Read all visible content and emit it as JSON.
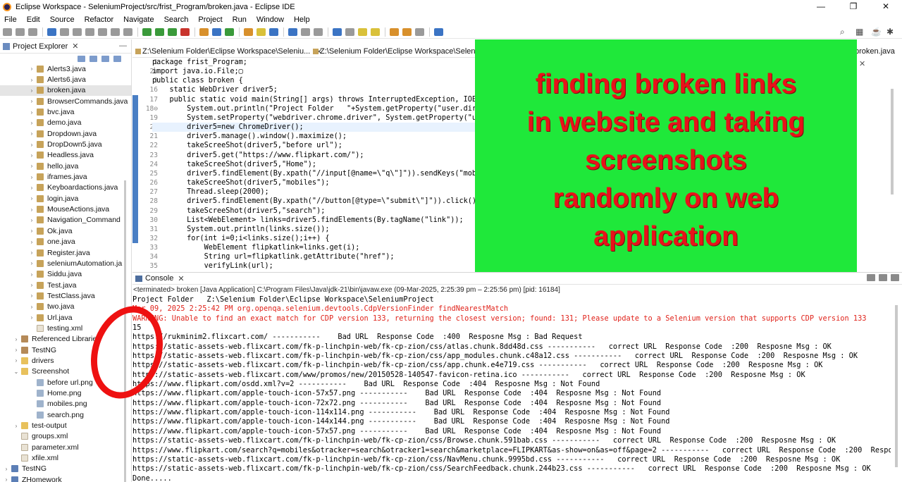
{
  "window": {
    "title": "Eclipse Workspace - SeleniumProject/src/frist_Program/broken.java - Eclipse IDE",
    "controls": [
      "—",
      "❐",
      "✕"
    ]
  },
  "menu": [
    "File",
    "Edit",
    "Source",
    "Refactor",
    "Navigate",
    "Search",
    "Project",
    "Run",
    "Window",
    "Help"
  ],
  "project_explorer": {
    "label": "Project Explorer",
    "close": "✕",
    "items": [
      {
        "name": "Alerts3.java",
        "type": "java",
        "level": 2
      },
      {
        "name": "Alerts6.java",
        "type": "java",
        "level": 2
      },
      {
        "name": "broken.java",
        "type": "java",
        "level": 2,
        "selected": true
      },
      {
        "name": "BrowserCommands.java",
        "type": "java",
        "level": 2
      },
      {
        "name": "bvc.java",
        "type": "java",
        "level": 2
      },
      {
        "name": "demo.java",
        "type": "java",
        "level": 2
      },
      {
        "name": "Dropdown.java",
        "type": "java",
        "level": 2
      },
      {
        "name": "DropDown5.java",
        "type": "java",
        "level": 2
      },
      {
        "name": "Headless.java",
        "type": "java",
        "level": 2
      },
      {
        "name": "hello.java",
        "type": "java",
        "level": 2
      },
      {
        "name": "iframes.java",
        "type": "java",
        "level": 2
      },
      {
        "name": "Keyboardactions.java",
        "type": "java",
        "level": 2
      },
      {
        "name": "login.java",
        "type": "java",
        "level": 2
      },
      {
        "name": "MouseActions.java",
        "type": "java",
        "level": 2
      },
      {
        "name": "Navigation_Command",
        "type": "java",
        "level": 2
      },
      {
        "name": "Ok.java",
        "type": "java",
        "level": 2
      },
      {
        "name": "one.java",
        "type": "java",
        "level": 2
      },
      {
        "name": "Register.java",
        "type": "java",
        "level": 2
      },
      {
        "name": "seleniumAutomation.ja",
        "type": "java",
        "level": 2
      },
      {
        "name": "Siddu.java",
        "type": "java",
        "level": 2
      },
      {
        "name": "Test.java",
        "type": "java",
        "level": 2
      },
      {
        "name": "TestClass.java",
        "type": "java",
        "level": 2
      },
      {
        "name": "two.java",
        "type": "java",
        "level": 2
      },
      {
        "name": "Url.java",
        "type": "java",
        "level": 2
      },
      {
        "name": "testing.xml",
        "type": "xml",
        "level": 2,
        "noarrow": true
      },
      {
        "name": "Referenced Libraries",
        "type": "lib",
        "level": 1
      },
      {
        "name": "TestNG",
        "type": "lib",
        "level": 1
      },
      {
        "name": "drivers",
        "type": "folder",
        "level": 1
      },
      {
        "name": "Screenshot",
        "type": "folder",
        "level": 1,
        "expanded": true
      },
      {
        "name": "before url.png",
        "type": "png",
        "level": 2,
        "noarrow": true
      },
      {
        "name": "Home.png",
        "type": "png",
        "level": 2,
        "noarrow": true
      },
      {
        "name": "mobiles.png",
        "type": "png",
        "level": 2,
        "noarrow": true
      },
      {
        "name": "search.png",
        "type": "png",
        "level": 2,
        "noarrow": true
      },
      {
        "name": "test-output",
        "type": "folder",
        "level": 1
      },
      {
        "name": "groups.xml",
        "type": "xml",
        "level": 1,
        "noarrow": true
      },
      {
        "name": "parameter.xml",
        "type": "xml",
        "level": 1,
        "noarrow": true
      },
      {
        "name": "xfile.xml",
        "type": "xml",
        "level": 1,
        "noarrow": true
      },
      {
        "name": "TestNG",
        "type": "proj",
        "level": 0
      },
      {
        "name": "ZHomework",
        "type": "proj",
        "level": 0
      }
    ]
  },
  "editor": {
    "tabs": [
      "Z:\\Selenium Folder\\Eclipse Workspace\\Seleniu...",
      "Z:\\Selenium Folder\\Eclipse Workspace\\Seleniu..."
    ],
    "active_tab": "broken.java",
    "line_numbers": [
      "1",
      "2⊕",
      "3",
      "16",
      "17",
      "18⊖",
      "19",
      "20",
      "21",
      "22",
      "23",
      "24",
      "25",
      "26",
      "27",
      "28",
      "29",
      "30",
      "31",
      "32",
      "33",
      "34",
      "35"
    ],
    "lines": [
      "package frist_Program;",
      "import java.io.File;▢",
      "public class broken {",
      "    static WebDriver driver5;",
      "    public static void main(String[] args) throws InterruptedException, IOExce",
      "        System.out.println(\"Project Folder   \"+System.getProperty(\"user.dir\"",
      "        System.setProperty(\"webdriver.chrome.driver\", System.getProperty(\"use",
      "        driver5=new ChromeDriver();",
      "        driver5.manage().window().maximize();",
      "        takeScreeShot(driver5,\"before url\");",
      "        driver5.get(\"https://www.flipkart.com/\");",
      "        takeScreeShot(driver5,\"Home\");",
      "        driver5.findElement(By.xpath(\"//input[@name=\\\"q\\\"]\")).sendKeys(\"mobil",
      "        takeScreeShot(driver5,\"mobiles\");",
      "        Thread.sleep(2000);",
      "        driver5.findElement(By.xpath(\"//button[@type=\\\"submit\\\"]\")).click();",
      "        takeScreeShot(driver5,\"search\");",
      "        List<WebElement> links=driver5.findElements(By.tagName(\"link\"));",
      "        System.out.println(links.size());",
      "        for(int i=0;i<links.size();i++) {",
      "            WebElement flipkatlink=links.get(i);",
      "            String url=flipkatlink.getAttribute(\"href\");",
      "            verifyLink(url);"
    ]
  },
  "banner": {
    "lines": [
      "finding broken links",
      "in website  and taking",
      "screenshots",
      "randomly on web",
      "application"
    ],
    "bg": "#1fe83a",
    "text_color": "#e8121a"
  },
  "console": {
    "label": "Console",
    "status": "<terminated> broken [Java Application] C:\\Program Files\\Java\\jdk-21\\bin\\javaw.exe  (09-Mar-2025, 2:25:39 pm – 2:25:56 pm) [pid: 16184]",
    "output": [
      {
        "text": "Project Folder   Z:\\Selenium Folder\\Eclipse Workspace\\SeleniumProject",
        "red": false
      },
      {
        "text": "Mar 09, 2025 2:25:42 PM org.openqa.selenium.devtools.CdpVersionFinder findNearestMatch",
        "red": true
      },
      {
        "text": "WARNING: Unable to find an exact match for CDP version 133, returning the closest version; found: 131; Please update to a Selenium version that supports CDP version 133",
        "red": true
      },
      {
        "text": "15",
        "red": false
      },
      {
        "text": "https://rukminim2.flixcart.com/ -----------    Bad URL  Response Code  :400  Resposne Msg : Bad Request",
        "red": false
      },
      {
        "text": "https://static-assets-web.flixcart.com/fk-p-linchpin-web/fk-cp-zion/css/atlas.chunk.8dd48d.css -----------   correct URL  Response Code  :200  Resposne Msg : OK",
        "red": false
      },
      {
        "text": "https://static-assets-web.flixcart.com/fk-p-linchpin-web/fk-cp-zion/css/app_modules.chunk.c48a12.css -----------   correct URL  Response Code  :200  Resposne Msg : OK",
        "red": false
      },
      {
        "text": "https://static-assets-web.flixcart.com/fk-p-linchpin-web/fk-cp-zion/css/app.chunk.e4e719.css -----------   correct URL  Response Code  :200  Resposne Msg : OK",
        "red": false
      },
      {
        "text": "https://static-assets-web.flixcart.com/www/promos/new/20150528-140547-favicon-retina.ico -----------   correct URL  Response Code  :200  Resposne Msg : OK",
        "red": false
      },
      {
        "text": "https://www.flipkart.com/osdd.xml?v=2 -----------    Bad URL  Response Code  :404  Resposne Msg : Not Found",
        "red": false
      },
      {
        "text": "https://www.flipkart.com/apple-touch-icon-57x57.png -----------    Bad URL  Response Code  :404  Resposne Msg : Not Found",
        "red": false
      },
      {
        "text": "https://www.flipkart.com/apple-touch-icon-72x72.png -----------    Bad URL  Response Code  :404  Resposne Msg : Not Found",
        "red": false
      },
      {
        "text": "https://www.flipkart.com/apple-touch-icon-114x114.png -----------    Bad URL  Response Code  :404  Resposne Msg : Not Found",
        "red": false
      },
      {
        "text": "https://www.flipkart.com/apple-touch-icon-144x144.png -----------    Bad URL  Response Code  :404  Resposne Msg : Not Found",
        "red": false
      },
      {
        "text": "https://www.flipkart.com/apple-touch-icon-57x57.png -----------    Bad URL  Response Code  :404  Resposne Msg : Not Found",
        "red": false
      },
      {
        "text": "https://static-assets-web.flixcart.com/fk-p-linchpin-web/fk-cp-zion/css/Browse.chunk.591bab.css -----------   correct URL  Response Code  :200  Resposne Msg : OK",
        "red": false
      },
      {
        "text": "https://www.flipkart.com/search?q=mobiles&otracker=search&otracker1=search&marketplace=FLIPKART&as-show=on&as=off&page=2 -----------   correct URL  Response Code  :200  Resposne M",
        "red": false
      },
      {
        "text": "https://static-assets-web.flixcart.com/fk-p-linchpin-web/fk-cp-zion/css/NavMenu.chunk.9995bd.css -----------   correct URL  Response Code  :200  Resposne Msg : OK",
        "red": false
      },
      {
        "text": "https://static-assets-web.flixcart.com/fk-p-linchpin-web/fk-cp-zion/css/SearchFeedback.chunk.244b23.css -----------   correct URL  Response Code  :200  Resposne Msg : OK",
        "red": false
      },
      {
        "text": "Done.....",
        "red": false
      }
    ]
  },
  "annotation": {
    "color": "#ee1111"
  }
}
